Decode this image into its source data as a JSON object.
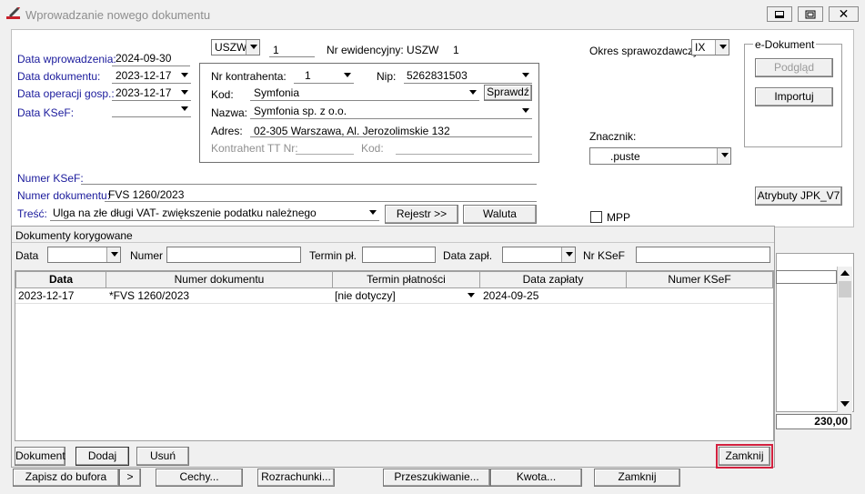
{
  "window": {
    "title": "Wprowadzanie nowego dokumentu",
    "minimize_label": "▭",
    "restore_label": "◫",
    "close_label": "✕"
  },
  "header": {
    "data_wprowadzenia_label": "Data wprowadzenia:",
    "data_wprowadzenia_value": "2024-09-30",
    "data_dokumentu_label": "Data dokumentu:",
    "data_dokumentu_value": "2023-12-17",
    "data_operacji_label": "Data operacji gosp.:",
    "data_operacji_value": "2023-12-17",
    "data_ksef_label": "Data KSeF:",
    "data_ksef_value": "",
    "rejestr_value": "USZW",
    "numer_value": "1",
    "nr_ewidencyjny_label": "Nr ewidencyjny: USZW",
    "nr_ewidencyjny_value": "1",
    "okres_label": "Okres sprawozdawczy:",
    "okres_value": "IX",
    "edokument_label": "e-Dokument",
    "podglad_label": "Podgląd",
    "importuj_label": "Importuj",
    "znacznik_label": "Znacznik:",
    "znacznik_value": ".puste",
    "atrybuty_label": "Atrybuty JPK_V7",
    "mpp_label": "MPP"
  },
  "kontrahent": {
    "nr_label": "Nr kontrahenta:",
    "nr_value": "1",
    "nip_label": "Nip:",
    "nip_value": "5262831503",
    "kod_label": "Kod:",
    "kod_value": "Symfonia",
    "sprawdz_label": "Sprawdź",
    "nazwa_label": "Nazwa:",
    "nazwa_value": "Symfonia sp. z o.o.",
    "adres_label": "Adres:",
    "adres_value": "02-305 Warszawa, Al. Jerozolimskie 132",
    "tt_nr_label": "Kontrahent TT Nr:",
    "tt_kod_label": "Kod:"
  },
  "doc": {
    "numer_ksef_label": "Numer KSeF:",
    "numer_ksef_value": "",
    "numer_dok_label": "Numer dokumentu:",
    "numer_dok_value": "FVS 1260/2023",
    "tresc_label": "Treść:",
    "tresc_value": "Ulga na złe długi VAT- zwiększenie podatku należnego",
    "rejestr_btn_label": "Rejestr >>",
    "waluta_label": "Waluta"
  },
  "corrected": {
    "title": "Dokumenty korygowane",
    "filter": {
      "data_label": "Data",
      "numer_label": "Numer",
      "termin_label": "Termin pł.",
      "data_zapl_label": "Data zapł.",
      "nr_ksef_label": "Nr KSeF"
    },
    "columns": [
      "Data",
      "Numer dokumentu",
      "Termin płatności",
      "Data zapłaty",
      "Numer KSeF"
    ],
    "rows": [
      {
        "data": "2023-12-17",
        "numer": "*FVS 1260/2023",
        "termin": "[nie dotyczy]",
        "data_zaplaty": "2024-09-25",
        "ksef": ""
      }
    ],
    "dokument_label": "Dokument",
    "dodaj_label": "Dodaj",
    "usun_label": "Usuń",
    "zamknij_label": "Zamknij"
  },
  "background": {
    "total_value": "230,00"
  },
  "bottom_toolbar": {
    "zapisz_label": "Zapisz do bufora",
    "more_label": ">",
    "cechy_label": "Cechy...",
    "rozrachunki_label": "Rozrachunki...",
    "przeszukiwanie_label": "Przeszukiwanie...",
    "kwota_label": "Kwota...",
    "zamknij_label": "Zamknij"
  }
}
